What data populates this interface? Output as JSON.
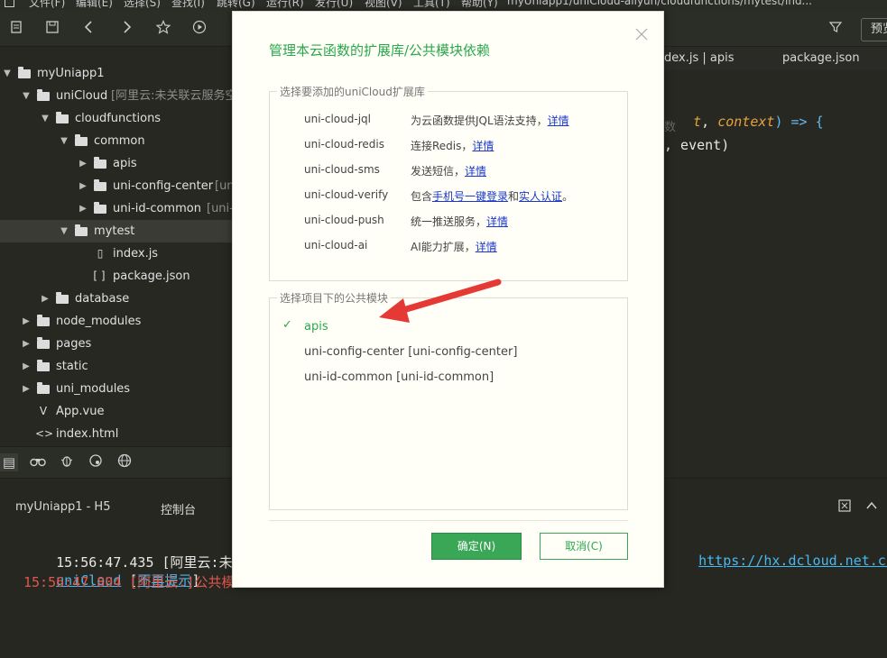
{
  "window": {
    "title": "myUniapp1/uniCloud-aliyun/cloudfunctions/mytest/ind...",
    "menu": [
      "文件(F)",
      "编辑(E)",
      "选择(S)",
      "查找(I)",
      "跳转(G)",
      "运行(R)",
      "发行(U)",
      "视图(V)",
      "工具(T)",
      "帮助(Y)"
    ]
  },
  "toolbar": {
    "preview_label": "预览"
  },
  "sidebar": {
    "items": [
      {
        "label": "myUniapp1",
        "extra": ""
      },
      {
        "label": "uniCloud",
        "extra": "[阿里云:未关联云服务空间"
      },
      {
        "label": "cloudfunctions",
        "extra": ""
      },
      {
        "label": "common",
        "extra": ""
      },
      {
        "label": "apis",
        "extra": ""
      },
      {
        "label": "uni-config-center",
        "extra": "[un"
      },
      {
        "label": "uni-id-common",
        "extra": "[uni-i"
      },
      {
        "label": "mytest",
        "extra": ""
      },
      {
        "label": "index.js",
        "extra": ""
      },
      {
        "label": "package.json",
        "extra": ""
      },
      {
        "label": "database",
        "extra": ""
      },
      {
        "label": "node_modules",
        "extra": ""
      },
      {
        "label": "pages",
        "extra": ""
      },
      {
        "label": "static",
        "extra": ""
      },
      {
        "label": "uni_modules",
        "extra": ""
      },
      {
        "label": "App.vue",
        "extra": ""
      },
      {
        "label": "index.html",
        "extra": ""
      }
    ]
  },
  "editor": {
    "tabs": [
      "dex.js | apis",
      "package.json"
    ],
    "code": {
      "line1_a": "t",
      "line1_b": ", ",
      "line1_c": "context",
      "line1_d": ") => {",
      "line2": "数",
      "line3": ", event)"
    }
  },
  "console": {
    "tabs": [
      "myUniapp1 - H5",
      "控制台"
    ],
    "line1_time": "15:56:47.435",
    "line1_text": " [阿里云:未绑定",
    "line1_url": "https://hx.dcloud.net.cn/cl",
    "line2_link": "uniCloud",
    "line2_text_a": " [",
    "line2_link2": "不再提示",
    "line2_text_b": "]",
    "line3": "15:56:47.804 [阿里云:]公共模"
  },
  "dialog": {
    "title": "管理本云函数的扩展库/公共模块依赖",
    "ext_group_title": "选择要添加的uniCloud扩展库",
    "extensions": [
      {
        "name": "uni-cloud-jql",
        "desc": "为云函数提供JQL语法支持，",
        "link": "详情"
      },
      {
        "name": "uni-cloud-redis",
        "desc": "连接Redis，",
        "link": "详情"
      },
      {
        "name": "uni-cloud-sms",
        "desc": "发送短信，",
        "link": "详情"
      },
      {
        "name": "uni-cloud-verify",
        "desc": "包含",
        "link": "手机号一键登录",
        "desc2": "和",
        "link2": "实人认证",
        "desc3": "。"
      },
      {
        "name": "uni-cloud-push",
        "desc": "统一推送服务，",
        "link": "详情"
      },
      {
        "name": "uni-cloud-ai",
        "desc": "AI能力扩展，",
        "link": "详情"
      }
    ],
    "module_group_title": "选择项目下的公共模块",
    "modules": [
      {
        "label": "apis",
        "checked": true
      },
      {
        "label": "uni-config-center [uni-config-center]",
        "checked": false
      },
      {
        "label": "uni-id-common [uni-id-common]",
        "checked": false
      }
    ],
    "ok_label": "确定(N)",
    "cancel_label": "取消(C)"
  },
  "colors": {
    "accent_green": "#3aa757",
    "annotation_red": "#e53935"
  }
}
